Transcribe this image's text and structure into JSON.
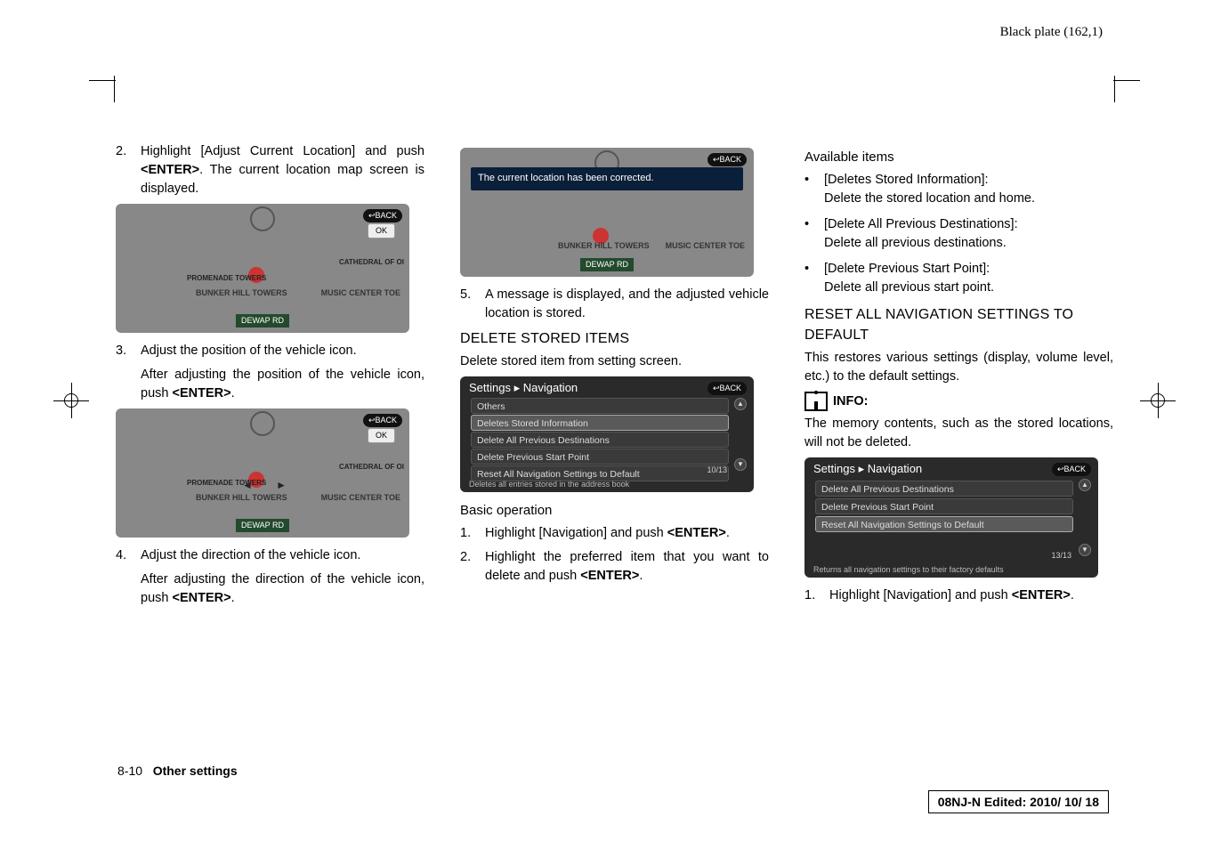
{
  "meta": {
    "plate": "Black plate (162,1)"
  },
  "col1": {
    "step2_num": "2.",
    "step2": "Highlight [Adjust Current Location] and push ",
    "step2_key": "<ENTER>",
    "step2_tail": ". The current location map screen is displayed.",
    "shot1": {
      "back": "↩BACK",
      "ok": "OK",
      "prom": "PROMENADE TOWERS",
      "hill": "BUNKER HILL TOWERS",
      "cath": "CATHEDRAL OF OI",
      "music": "MUSIC CENTER TOE",
      "road": "DEWAP RD"
    },
    "step3_num": "3.",
    "step3": "Adjust the position of the vehicle icon.",
    "step3_after": "After adjusting the position of the vehicle icon, push ",
    "step3_key": "<ENTER>",
    "step3_dot": ".",
    "step4_num": "4.",
    "step4": "Adjust the direction of the vehicle icon.",
    "step4_after": "After adjusting the direction of the vehicle icon, push ",
    "step4_key": "<ENTER>",
    "step4_dot": "."
  },
  "col2": {
    "shot_banner": "The current location has been corrected.",
    "shot1": {
      "back": "↩BACK",
      "hill": "BUNKER HILL TOWERS",
      "music": "MUSIC CENTER TOE",
      "road": "DEWAP RD"
    },
    "step5_num": "5.",
    "step5": "A message is displayed, and the adjusted vehicle location is stored.",
    "h_delete": "DELETE STORED ITEMS",
    "delete_sub": "Delete stored item from setting screen.",
    "settings_hdr": "Settings ▸ Navigation",
    "rows": {
      "r1": "Others",
      "r2": "Deletes Stored Information",
      "r3": "Delete All Previous Destinations",
      "r4": "Delete Previous Start Point",
      "r5": "Reset All Navigation Settings to Default"
    },
    "count": "10/13",
    "foot": "Deletes all entries stored in the address book",
    "h_basic": "Basic operation",
    "b1_num": "1.",
    "b1": "Highlight [Navigation] and push ",
    "b1_key": "<ENTER>",
    "b1_dot": ".",
    "b2_num": "2.",
    "b2": "Highlight the preferred item that you want to delete and push ",
    "b2_key": "<ENTER>",
    "b2_dot": "."
  },
  "col3": {
    "h_avail": "Available items",
    "it1a": "[Deletes Stored Information]:",
    "it1b": "Delete the stored location and home.",
    "it2a": "[Delete All Previous Destinations]:",
    "it2b": "Delete all previous destinations.",
    "it3a": "[Delete Previous Start Point]:",
    "it3b": "Delete all previous start point.",
    "h_reset": "RESET ALL NAVIGATION SETTINGS TO DEFAULT",
    "reset_p": "This restores various settings (display, volume level, etc.) to the default settings.",
    "info_lbl": "INFO:",
    "info_p": "The memory contents, such as the stored locations, will not be deleted.",
    "settings_hdr": "Settings ▸ Navigation",
    "rows": {
      "r1": "Delete All Previous Destinations",
      "r2": "Delete Previous Start Point",
      "r3": "Reset All Navigation Settings to Default"
    },
    "count": "13/13",
    "foot": "Returns all navigation settings to their factory defaults",
    "s1_num": "1.",
    "s1": "Highlight [Navigation] and push ",
    "s1_key": "<ENTER>",
    "s1_dot": "."
  },
  "footer": {
    "page": "8-10",
    "section": "Other settings",
    "stamp": "08NJ-N Edited:  2010/ 10/ 18"
  }
}
